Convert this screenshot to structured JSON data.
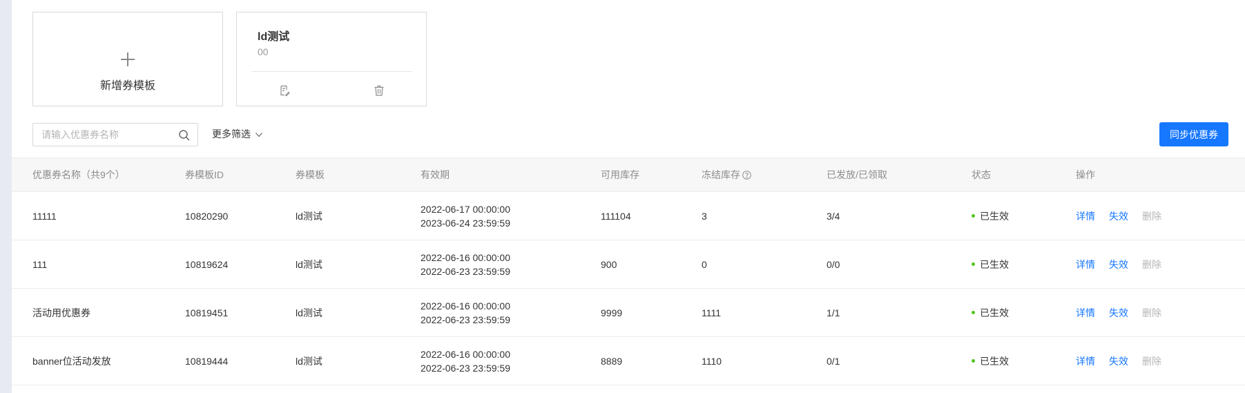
{
  "add_card": {
    "label": "新增券模板"
  },
  "template_card": {
    "name": "ld测试",
    "desc": "00"
  },
  "filters": {
    "search_placeholder": "请输入优惠券名称",
    "more_filter_label": "更多筛选",
    "sync_button_label": "同步优惠券"
  },
  "table": {
    "headers": {
      "name": "优惠券名称（共9个）",
      "template_id": "券模板ID",
      "template": "券模板",
      "period": "有效期",
      "available_stock": "可用库存",
      "frozen_stock": "冻结库存",
      "issued_received": "已发放/已领取",
      "status": "状态",
      "actions": "操作"
    },
    "rows": [
      {
        "name": "11111",
        "template_id": "10820290",
        "template": "ld测试",
        "start": "2022-06-17 00:00:00",
        "end": "2023-06-24 23:59:59",
        "available_stock": "111104",
        "frozen_stock": "3",
        "issued_received": "3/4",
        "status": "已生效",
        "detail": "详情",
        "invalidate": "失效",
        "delete": "删除"
      },
      {
        "name": "111",
        "template_id": "10819624",
        "template": "ld测试",
        "start": "2022-06-16 00:00:00",
        "end": "2022-06-23 23:59:59",
        "available_stock": "900",
        "frozen_stock": "0",
        "issued_received": "0/0",
        "status": "已生效",
        "detail": "详情",
        "invalidate": "失效",
        "delete": "删除"
      },
      {
        "name": "活动用优惠券",
        "template_id": "10819451",
        "template": "ld测试",
        "start": "2022-06-16 00:00:00",
        "end": "2022-06-23 23:59:59",
        "available_stock": "9999",
        "frozen_stock": "1111",
        "issued_received": "1/1",
        "status": "已生效",
        "detail": "详情",
        "invalidate": "失效",
        "delete": "删除"
      },
      {
        "name": "banner位活动发放",
        "template_id": "10819444",
        "template": "ld测试",
        "start": "2022-06-16 00:00:00",
        "end": "2022-06-23 23:59:59",
        "available_stock": "8889",
        "frozen_stock": "1110",
        "issued_received": "0/1",
        "status": "已生效",
        "detail": "详情",
        "invalidate": "失效",
        "delete": "删除"
      }
    ]
  },
  "colors": {
    "primary": "#1677ff",
    "status_active": "#52c41a",
    "header_bg": "#f7f7f7",
    "left_strip": "#e8eaf3"
  },
  "icons": {
    "add": "plus-icon",
    "edit": "edit-icon",
    "delete": "trash-icon",
    "search": "search-icon",
    "more": "chevron-down-icon",
    "help": "question-circle-icon"
  }
}
